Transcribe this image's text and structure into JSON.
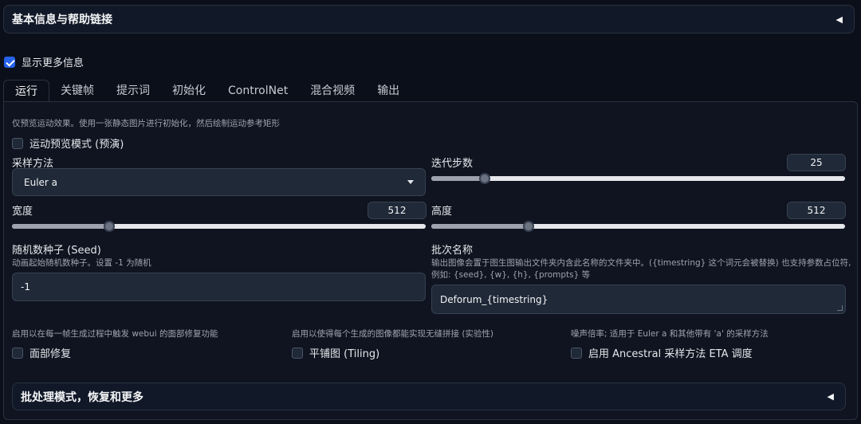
{
  "header_accordion": {
    "title": "基本信息与帮助链接",
    "toggle": "◀"
  },
  "show_more": {
    "label": "显示更多信息",
    "checked": true
  },
  "tabs": [
    {
      "label": "运行",
      "active": true
    },
    {
      "label": "关键帧"
    },
    {
      "label": "提示词"
    },
    {
      "label": "初始化"
    },
    {
      "label": "ControlNet"
    },
    {
      "label": "混合视频"
    },
    {
      "label": "输出"
    }
  ],
  "run": {
    "intro_hint": "仅预览运动效果。使用一张静态图片进行初始化，然后绘制运动参考矩形",
    "motion_preview": {
      "label": "运动预览模式 (预演)",
      "checked": false
    },
    "sampler": {
      "label": "采样方法",
      "value": "Euler a"
    },
    "steps": {
      "label": "迭代步数",
      "value": "25",
      "fraction": 0.13
    },
    "width": {
      "label": "宽度",
      "value": "512",
      "fraction": 0.235
    },
    "height": {
      "label": "高度",
      "value": "512",
      "fraction": 0.235
    },
    "seed": {
      "label": "随机数种子 (Seed)",
      "hint": "动画起始随机数种子。设置 -1 为随机",
      "value": "-1"
    },
    "batch_name": {
      "label": "批次名称",
      "hint_line1": "输出图像会置于图生图输出文件夹内含此名称的文件夹中。({timestring} 这个词元会被替换) 也支持参数占位符,",
      "hint_line2": "例如: {seed}, {w}, {h}, {prompts} 等",
      "value": "Deforum_{timestring}"
    },
    "restore_faces": {
      "hint": "启用以在每一帧生成过程中触发 webui 的面部修复功能",
      "label": "面部修复",
      "checked": false
    },
    "tiling": {
      "hint": "启用以使得每个生成的图像都能实现无缝拼接 (实验性)",
      "label": "平铺图 (Tiling)",
      "checked": false
    },
    "eta": {
      "hint": "噪声倍率; 适用于 Euler a 和其他带有 'a' 的采样方法",
      "label": "启用 Ancestral 采样方法 ETA 调度",
      "checked": false
    }
  },
  "batch_accordion": {
    "title": "批处理模式，恢复和更多",
    "toggle": "◀"
  }
}
